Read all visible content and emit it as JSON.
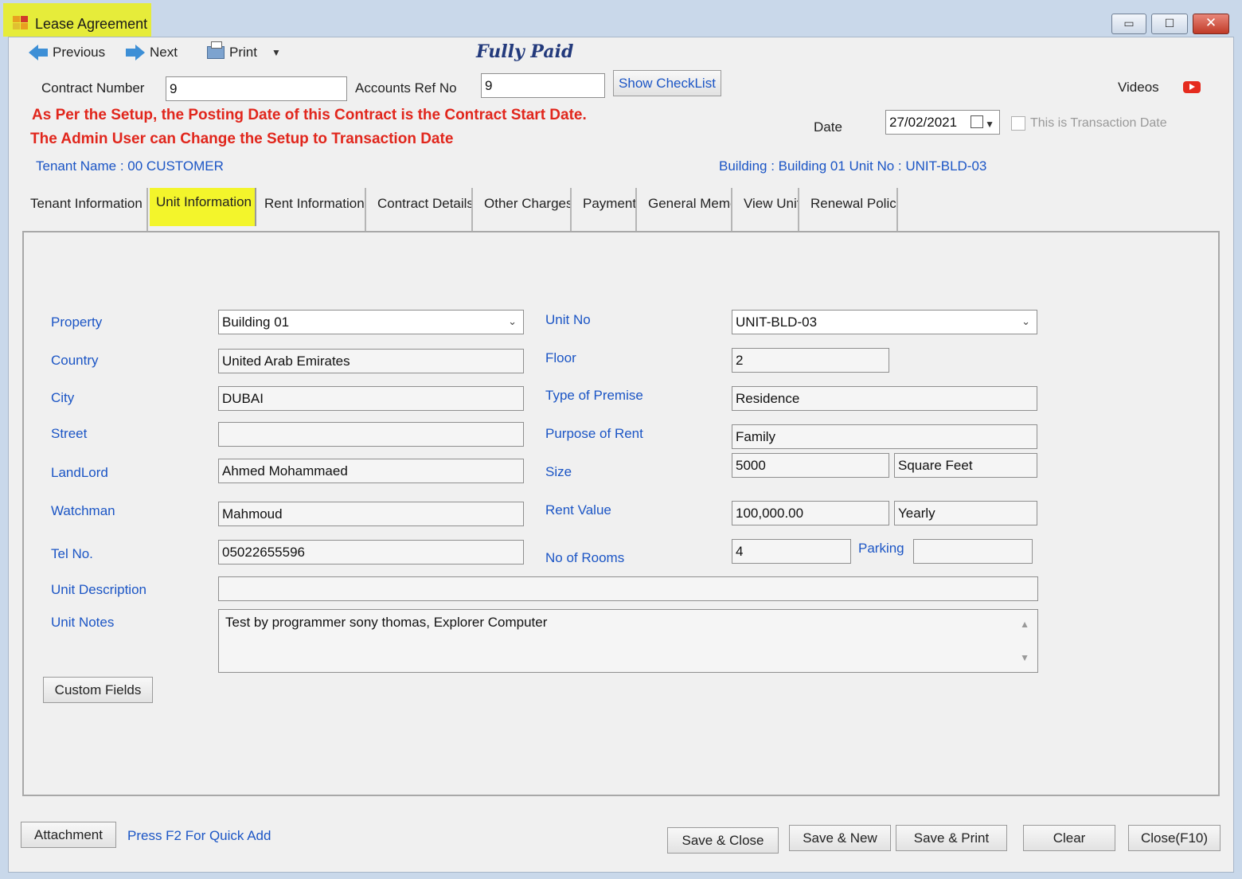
{
  "window": {
    "title": "Lease Agreement",
    "minimize": "▭",
    "maximize": "☐",
    "close": "✕"
  },
  "toolbar": {
    "previous": "Previous",
    "next": "Next",
    "print": "Print",
    "status": "Fully Paid"
  },
  "header": {
    "contract_number_label": "Contract Number",
    "contract_number": "9",
    "accounts_ref_label": "Accounts Ref No",
    "accounts_ref": "9",
    "show_checklist": "Show CheckList",
    "videos_label": "Videos",
    "warning_line1": "As Per the Setup, the Posting Date of this Contract is the Contract Start Date.",
    "warning_line2": "The Admin User can Change the Setup to Transaction Date",
    "date_label": "Date",
    "date_value": "27/02/2021",
    "transaction_date_label": "This is Transaction Date",
    "tenant_name": "Tenant Name : 00 CUSTOMER",
    "building_unit": "Building : Building 01  Unit No : UNIT-BLD-03"
  },
  "tabs": [
    {
      "label": "Tenant Information"
    },
    {
      "label": "Unit Information"
    },
    {
      "label": "Rent Information"
    },
    {
      "label": "Contract Details"
    },
    {
      "label": "Other Charges"
    },
    {
      "label": "Payment"
    },
    {
      "label": "General Memo"
    },
    {
      "label": "View Unit"
    },
    {
      "label": "Renewal Policy"
    }
  ],
  "unit_info": {
    "property_label": "Property",
    "property": "Building 01",
    "country_label": "Country",
    "country": "United Arab Emirates",
    "city_label": "City",
    "city": "DUBAI",
    "street_label": "Street",
    "street": "",
    "landlord_label": "LandLord",
    "landlord": "Ahmed Mohammaed",
    "watchman_label": "Watchman",
    "watchman": "Mahmoud",
    "tel_label": "Tel No.",
    "tel": "05022655596",
    "unit_description_label": "Unit Description",
    "unit_description": "",
    "unit_notes_label": "Unit Notes",
    "unit_notes": "Test by programmer sony thomas, Explorer Computer",
    "unit_no_label": "Unit No",
    "unit_no": "UNIT-BLD-03",
    "floor_label": "Floor",
    "floor": "2",
    "type_label": "Type of Premise",
    "type": "Residence",
    "purpose_label": "Purpose of Rent",
    "purpose": "Family",
    "size_label": "Size",
    "size": "5000",
    "size_unit": "Square Feet",
    "rent_label": "Rent Value",
    "rent": "100,000.00",
    "rent_period": "Yearly",
    "rooms_label": "No of Rooms",
    "rooms": "4",
    "parking_label": "Parking",
    "parking": "",
    "custom_fields": "Custom Fields"
  },
  "footer": {
    "attachment": "Attachment",
    "quick_add_hint": "Press F2 For Quick Add",
    "save_close": "Save & Close",
    "save_new": "Save & New",
    "save_print": "Save & Print",
    "clear": "Clear",
    "close": "Close(F10)"
  },
  "colors": {
    "label_blue": "#1b55c5",
    "warning_red": "#e1261c",
    "highlight_yellow": "#f3f52b",
    "status_navy": "#233a7c"
  }
}
